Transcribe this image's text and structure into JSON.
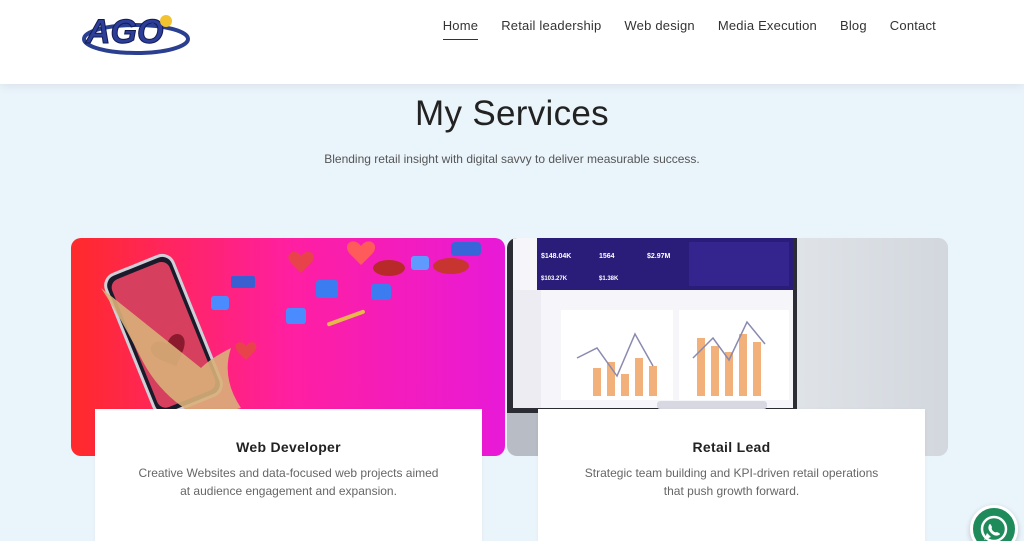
{
  "header": {
    "logo_text": "AGO",
    "nav": [
      {
        "label": "Home",
        "active": true
      },
      {
        "label": "Retail leadership"
      },
      {
        "label": "Web design"
      },
      {
        "label": "Media Execution"
      },
      {
        "label": "Blog"
      },
      {
        "label": "Contact"
      }
    ]
  },
  "section": {
    "title": "My Services",
    "subtitle": "Blending retail insight with digital savvy to deliver measurable success."
  },
  "cards": [
    {
      "title": "Web Developer",
      "description": "Creative Websites and data-focused web projects aimed at audience engagement and expansion."
    },
    {
      "title": "Retail Lead",
      "description": "Strategic team building and KPI-driven retail operations that push growth forward."
    }
  ],
  "dashboard": {
    "stat1": "$148.04K",
    "stat2": "1564",
    "stat3": "$2.97M",
    "stat4": "$103.27K",
    "stat5": "$1.38K"
  },
  "colors": {
    "accent": "#1f8a5a",
    "background": "#eaf4fb",
    "dashboard_navy": "#2a1d7a"
  }
}
